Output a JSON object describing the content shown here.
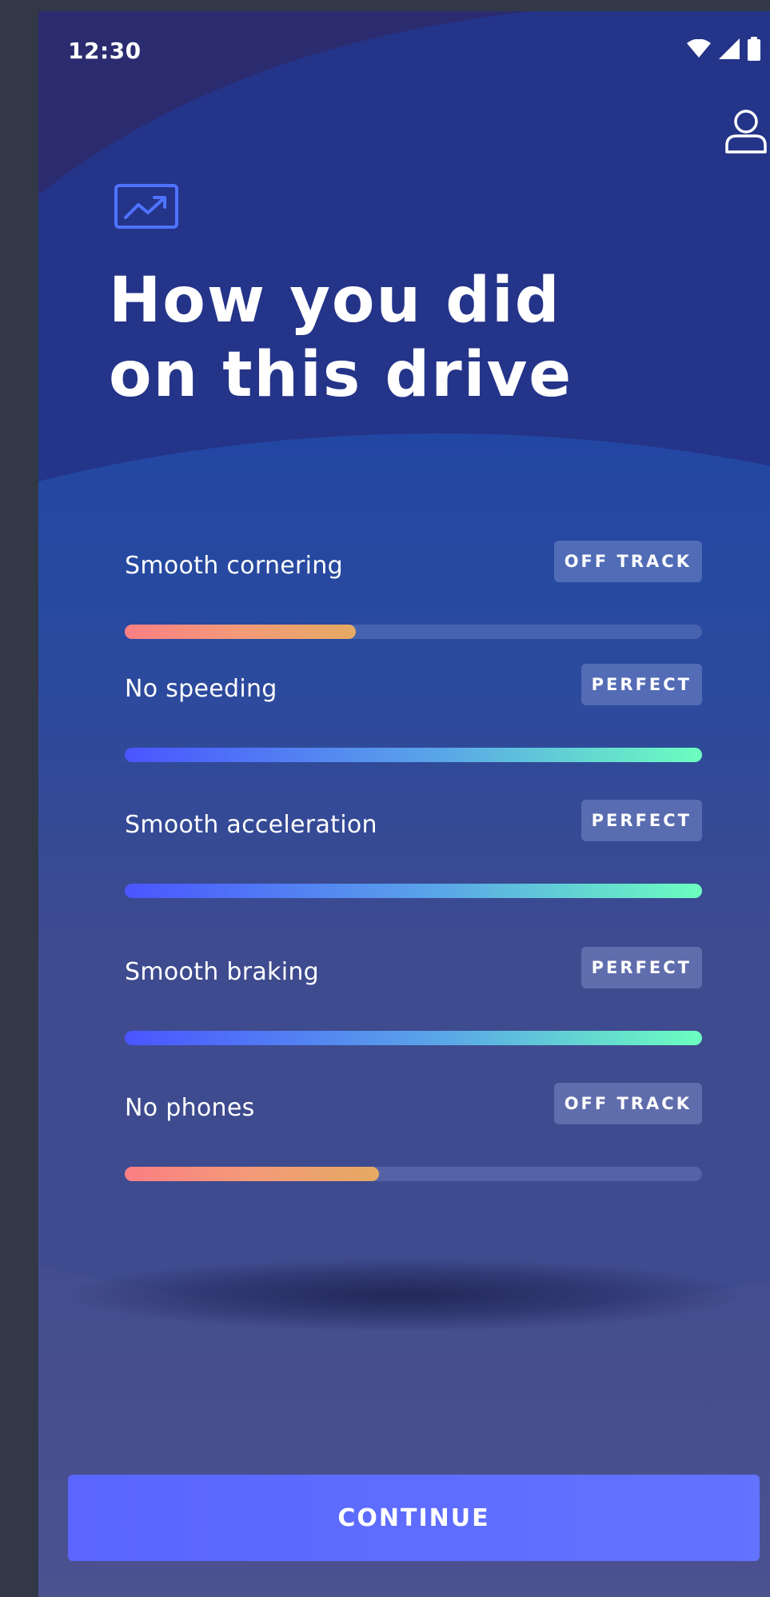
{
  "status_bar": {
    "time": "12:30",
    "icons": [
      "wifi-icon",
      "cellular-signal-icon",
      "battery-icon"
    ]
  },
  "header": {
    "icon": "trending-chart-icon",
    "title": "How you did on this drive",
    "profile_icon": "profile-icon"
  },
  "metrics": [
    {
      "label": "Smooth cornering",
      "status": "OFF TRACK",
      "level": 0.4
    },
    {
      "label": "No speeding",
      "status": "PERFECT",
      "level": 1.0
    },
    {
      "label": "Smooth acceleration",
      "status": "PERFECT",
      "level": 1.0
    },
    {
      "label": "Smooth braking",
      "status": "PERFECT",
      "level": 1.0
    },
    {
      "label": "No phones",
      "status": "OFF TRACK",
      "level": 0.44
    }
  ],
  "colors": {
    "accent": "#5e6cff",
    "perfect_gradient_start": "#4a55ff",
    "perfect_gradient_end": "#6cffbf",
    "offtrack_gradient_start": "#fb7f84",
    "offtrack_gradient_end": "#e5aa63"
  },
  "footer": {
    "continue_label": "CONTINUE"
  }
}
